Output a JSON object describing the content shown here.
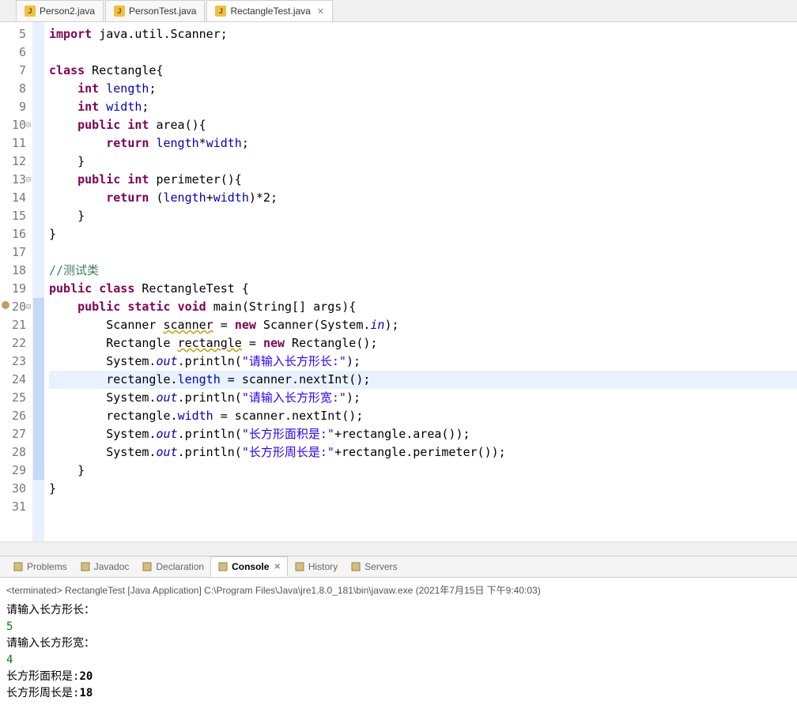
{
  "tabs": [
    {
      "label": "Person2.java"
    },
    {
      "label": "PersonTest.java"
    },
    {
      "label": "RectangleTest.java",
      "active": true
    }
  ],
  "editor": {
    "highlighted_line": 24,
    "lines": [
      {
        "n": 5,
        "tokens": [
          [
            "kw",
            "import"
          ],
          [
            "",
            " java.util.Scanner;"
          ]
        ]
      },
      {
        "n": 6,
        "tokens": [
          [
            "",
            ""
          ]
        ]
      },
      {
        "n": 7,
        "tokens": [
          [
            "kw",
            "class"
          ],
          [
            "",
            " Rectangle{"
          ]
        ]
      },
      {
        "n": 8,
        "tokens": [
          [
            "",
            "    "
          ],
          [
            "kw",
            "int"
          ],
          [
            "",
            " "
          ],
          [
            "field",
            "length"
          ],
          [
            "",
            ";"
          ]
        ]
      },
      {
        "n": 9,
        "tokens": [
          [
            "",
            "    "
          ],
          [
            "kw",
            "int"
          ],
          [
            "",
            " "
          ],
          [
            "field",
            "width"
          ],
          [
            "",
            ";"
          ]
        ]
      },
      {
        "n": 10,
        "fold": true,
        "tokens": [
          [
            "",
            "    "
          ],
          [
            "kw",
            "public"
          ],
          [
            "",
            " "
          ],
          [
            "kw",
            "int"
          ],
          [
            "",
            " area(){"
          ]
        ]
      },
      {
        "n": 11,
        "tokens": [
          [
            "",
            "        "
          ],
          [
            "kw",
            "return"
          ],
          [
            "",
            " "
          ],
          [
            "field",
            "length"
          ],
          [
            "",
            "*"
          ],
          [
            "field",
            "width"
          ],
          [
            "",
            ";"
          ]
        ]
      },
      {
        "n": 12,
        "tokens": [
          [
            "",
            "    }"
          ]
        ]
      },
      {
        "n": 13,
        "fold": true,
        "tokens": [
          [
            "",
            "    "
          ],
          [
            "kw",
            "public"
          ],
          [
            "",
            " "
          ],
          [
            "kw",
            "int"
          ],
          [
            "",
            " perimeter(){"
          ]
        ]
      },
      {
        "n": 14,
        "tokens": [
          [
            "",
            "        "
          ],
          [
            "kw",
            "return"
          ],
          [
            "",
            " ("
          ],
          [
            "field",
            "length"
          ],
          [
            "",
            "+"
          ],
          [
            "field",
            "width"
          ],
          [
            "",
            ")*2;"
          ]
        ]
      },
      {
        "n": 15,
        "tokens": [
          [
            "",
            "    }"
          ]
        ]
      },
      {
        "n": 16,
        "tokens": [
          [
            "",
            "}"
          ]
        ]
      },
      {
        "n": 17,
        "tokens": [
          [
            "",
            ""
          ]
        ]
      },
      {
        "n": 18,
        "tokens": [
          [
            "cmt",
            "//测试类"
          ]
        ]
      },
      {
        "n": 19,
        "tokens": [
          [
            "kw",
            "public"
          ],
          [
            "",
            " "
          ],
          [
            "kw",
            "class"
          ],
          [
            "",
            " RectangleTest {"
          ]
        ]
      },
      {
        "n": 20,
        "fold": true,
        "marker": true,
        "ruler_start": true,
        "tokens": [
          [
            "",
            "    "
          ],
          [
            "kw",
            "public"
          ],
          [
            "",
            " "
          ],
          [
            "kw",
            "static"
          ],
          [
            "",
            " "
          ],
          [
            "kw",
            "void"
          ],
          [
            "",
            " main(String[] args){"
          ]
        ]
      },
      {
        "n": 21,
        "ruler": true,
        "tokens": [
          [
            "",
            "        Scanner "
          ],
          [
            "underline",
            "scanner"
          ],
          [
            "",
            " = "
          ],
          [
            "kw",
            "new"
          ],
          [
            "",
            " Scanner(System."
          ],
          [
            "stat",
            "in"
          ],
          [
            "",
            ");"
          ]
        ]
      },
      {
        "n": 22,
        "ruler": true,
        "tokens": [
          [
            "",
            "        Rectangle "
          ],
          [
            "underline",
            "rectangle"
          ],
          [
            "",
            " = "
          ],
          [
            "kw",
            "new"
          ],
          [
            "",
            " Rectangle();"
          ]
        ]
      },
      {
        "n": 23,
        "ruler": true,
        "tokens": [
          [
            "",
            "        System."
          ],
          [
            "stat",
            "out"
          ],
          [
            "",
            ".println("
          ],
          [
            "str",
            "\"请输入长方形长:\""
          ],
          [
            "",
            ");"
          ]
        ]
      },
      {
        "n": 24,
        "ruler": true,
        "tokens": [
          [
            "",
            "        rectangle."
          ],
          [
            "field",
            "length"
          ],
          [
            "",
            " = scanner.nextInt();"
          ]
        ]
      },
      {
        "n": 25,
        "ruler": true,
        "tokens": [
          [
            "",
            "        System."
          ],
          [
            "stat",
            "out"
          ],
          [
            "",
            ".println("
          ],
          [
            "str",
            "\"请输入长方形宽:\""
          ],
          [
            "",
            ");"
          ]
        ]
      },
      {
        "n": 26,
        "ruler": true,
        "tokens": [
          [
            "",
            "        rectangle."
          ],
          [
            "field",
            "width"
          ],
          [
            "",
            " = scanner.nextInt();"
          ]
        ]
      },
      {
        "n": 27,
        "ruler": true,
        "tokens": [
          [
            "",
            "        System."
          ],
          [
            "stat",
            "out"
          ],
          [
            "",
            ".println("
          ],
          [
            "str",
            "\"长方形面积是:\""
          ],
          [
            "",
            "+rectangle.area());"
          ]
        ]
      },
      {
        "n": 28,
        "ruler": true,
        "tokens": [
          [
            "",
            "        System."
          ],
          [
            "stat",
            "out"
          ],
          [
            "",
            ".println("
          ],
          [
            "str",
            "\"长方形周长是:\""
          ],
          [
            "",
            "+rectangle.perimeter());"
          ]
        ]
      },
      {
        "n": 29,
        "ruler_end": true,
        "tokens": [
          [
            "",
            "    }"
          ]
        ]
      },
      {
        "n": 30,
        "tokens": [
          [
            "",
            "}"
          ]
        ]
      },
      {
        "n": 31,
        "tokens": [
          [
            "",
            ""
          ]
        ]
      }
    ]
  },
  "bottom_tabs": [
    {
      "label": "Problems"
    },
    {
      "label": "Javadoc"
    },
    {
      "label": "Declaration"
    },
    {
      "label": "Console",
      "active": true
    },
    {
      "label": "History"
    },
    {
      "label": "Servers"
    }
  ],
  "console": {
    "header": "<terminated> RectangleTest [Java Application] C:\\Program Files\\Java\\jre1.8.0_181\\bin\\javaw.exe (2021年7月15日 下午9:40:03)",
    "lines": [
      {
        "text": "请输入长方形长：",
        "input": false
      },
      {
        "text": "5",
        "input": true
      },
      {
        "text": "请输入长方形宽：",
        "input": false
      },
      {
        "text": "4",
        "input": true
      },
      {
        "text_parts": [
          "长方形面积是:",
          "20"
        ]
      },
      {
        "text_parts": [
          "长方形周长是:",
          "18"
        ]
      }
    ]
  }
}
